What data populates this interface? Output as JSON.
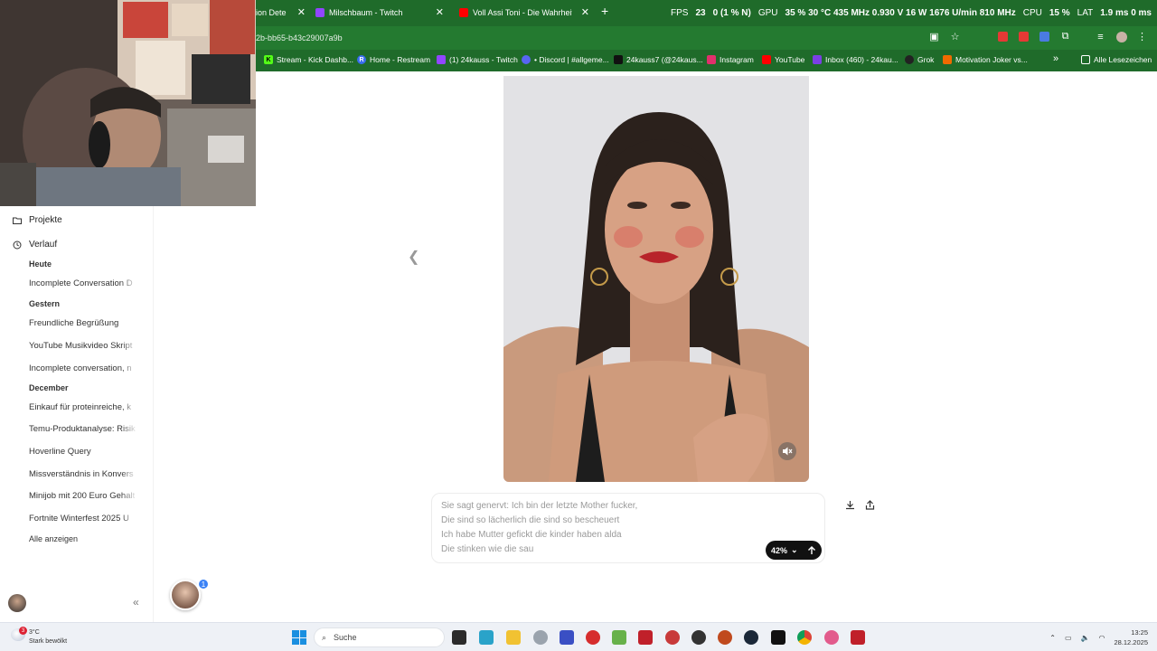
{
  "browser": {
    "tabs": [
      {
        "title": "ion Dete",
        "color": "#1f6b2a"
      },
      {
        "title": "Milschbaum - Twitch",
        "color": "#9146ff"
      },
      {
        "title": "Voll Assi Toni - Die Wahrheit (D",
        "color": "#ff0000"
      }
    ],
    "new_tab": "+",
    "url": "2b-bb65-b43c29007a9b",
    "bookmarks": [
      {
        "label": "Stream - Kick Dashb...",
        "icon": "K",
        "color": "#53fc18"
      },
      {
        "label": "Home - Restream",
        "icon": "R",
        "color": "#3a6df0"
      },
      {
        "label": "(1) 24kauss - Twitch",
        "icon": "",
        "color": "#9146ff"
      },
      {
        "label": "• Discord | #allgeme...",
        "icon": "",
        "color": "#5865f2"
      },
      {
        "label": "24kauss7 (@24kaus...",
        "icon": "",
        "color": "#111111"
      },
      {
        "label": "Instagram",
        "icon": "",
        "color": "#e1306c"
      },
      {
        "label": "YouTube",
        "icon": "",
        "color": "#ff0000"
      },
      {
        "label": "Inbox (460) - 24kau...",
        "icon": "",
        "color": "#7b3fe4"
      },
      {
        "label": "Grok",
        "icon": "",
        "color": "#222222"
      },
      {
        "label": "Motivation Joker vs...",
        "icon": "",
        "color": "#f06a00"
      }
    ],
    "bookmarks_overflow": "»",
    "all_bookmarks": "Alle Lesezeichen"
  },
  "overlay": {
    "fps_label": "FPS",
    "fps_value": "23",
    "fps_extra": "0 (1 % N)",
    "gpu_label": "GPU",
    "gpu_value": "35 % 30 °C 435 MHz 0.930 V 16 W 1676 U/min 810 MHz",
    "cpu_label": "CPU",
    "cpu_value": "15 %",
    "lat_label": "LAT",
    "lat_value": "1.9 ms 0 ms"
  },
  "sidebar": {
    "projects": "Projekte",
    "history": "Verlauf",
    "sections": [
      {
        "title": "Heute",
        "items": [
          "Incomplete Conversation D"
        ]
      },
      {
        "title": "Gestern",
        "items": [
          "Freundliche Begrüßung",
          "YouTube Musikvideo Skript",
          "Incomplete conversation, n"
        ]
      },
      {
        "title": "December",
        "items": [
          "Einkauf für proteinreiche, k",
          "Temu-Produktanalyse: Risik",
          "Hoverline Query",
          "Missverständnis in Konvers",
          "Minijob mit 200 Euro Gehalt",
          "Fortnite Winterfest 2025 U"
        ]
      }
    ],
    "show_all": "Alle anzeigen",
    "collapse": "«",
    "notif_count": "1"
  },
  "main": {
    "prompt_lines": [
      "Sie sagt genervt: Ich bin der letzte Mother fucker,",
      "Die sind so lächerlich die sind so bescheuert",
      "Ich habe Mutter gefickt die kinder haben alda",
      "Die stinken wie die sau"
    ],
    "progress_label": "42%"
  },
  "taskbar": {
    "weather_temp": "3°C",
    "weather_desc": "Stark bewölkt",
    "weather_badge": "3",
    "search_label": "Suche",
    "time": "13:25",
    "date": "28.12.2025"
  }
}
